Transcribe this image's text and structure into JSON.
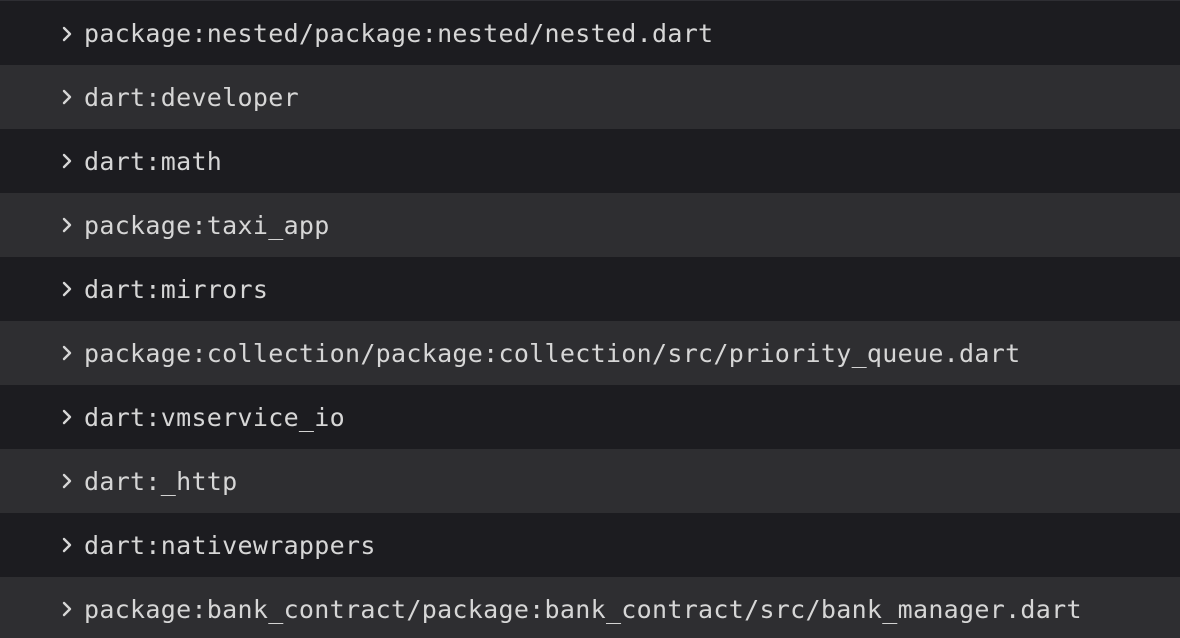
{
  "library_tree": {
    "items": [
      {
        "label": "package:nested/package:nested/nested.dart",
        "icon": "chevron-right-icon"
      },
      {
        "label": "dart:developer",
        "icon": "chevron-right-icon"
      },
      {
        "label": "dart:math",
        "icon": "chevron-right-icon"
      },
      {
        "label": "package:taxi_app",
        "icon": "chevron-right-icon"
      },
      {
        "label": "dart:mirrors",
        "icon": "chevron-right-icon"
      },
      {
        "label": "package:collection/package:collection/src/priority_queue.dart",
        "icon": "chevron-right-icon"
      },
      {
        "label": "dart:vmservice_io",
        "icon": "chevron-right-icon"
      },
      {
        "label": "dart:_http",
        "icon": "chevron-right-icon"
      },
      {
        "label": "dart:nativewrappers",
        "icon": "chevron-right-icon"
      },
      {
        "label": "package:bank_contract/package:bank_contract/src/bank_manager.dart",
        "icon": "chevron-right-icon"
      }
    ]
  },
  "colors": {
    "row_dark": "#1c1c20",
    "row_light": "#2e2e31",
    "text": "#d6d6d6"
  }
}
